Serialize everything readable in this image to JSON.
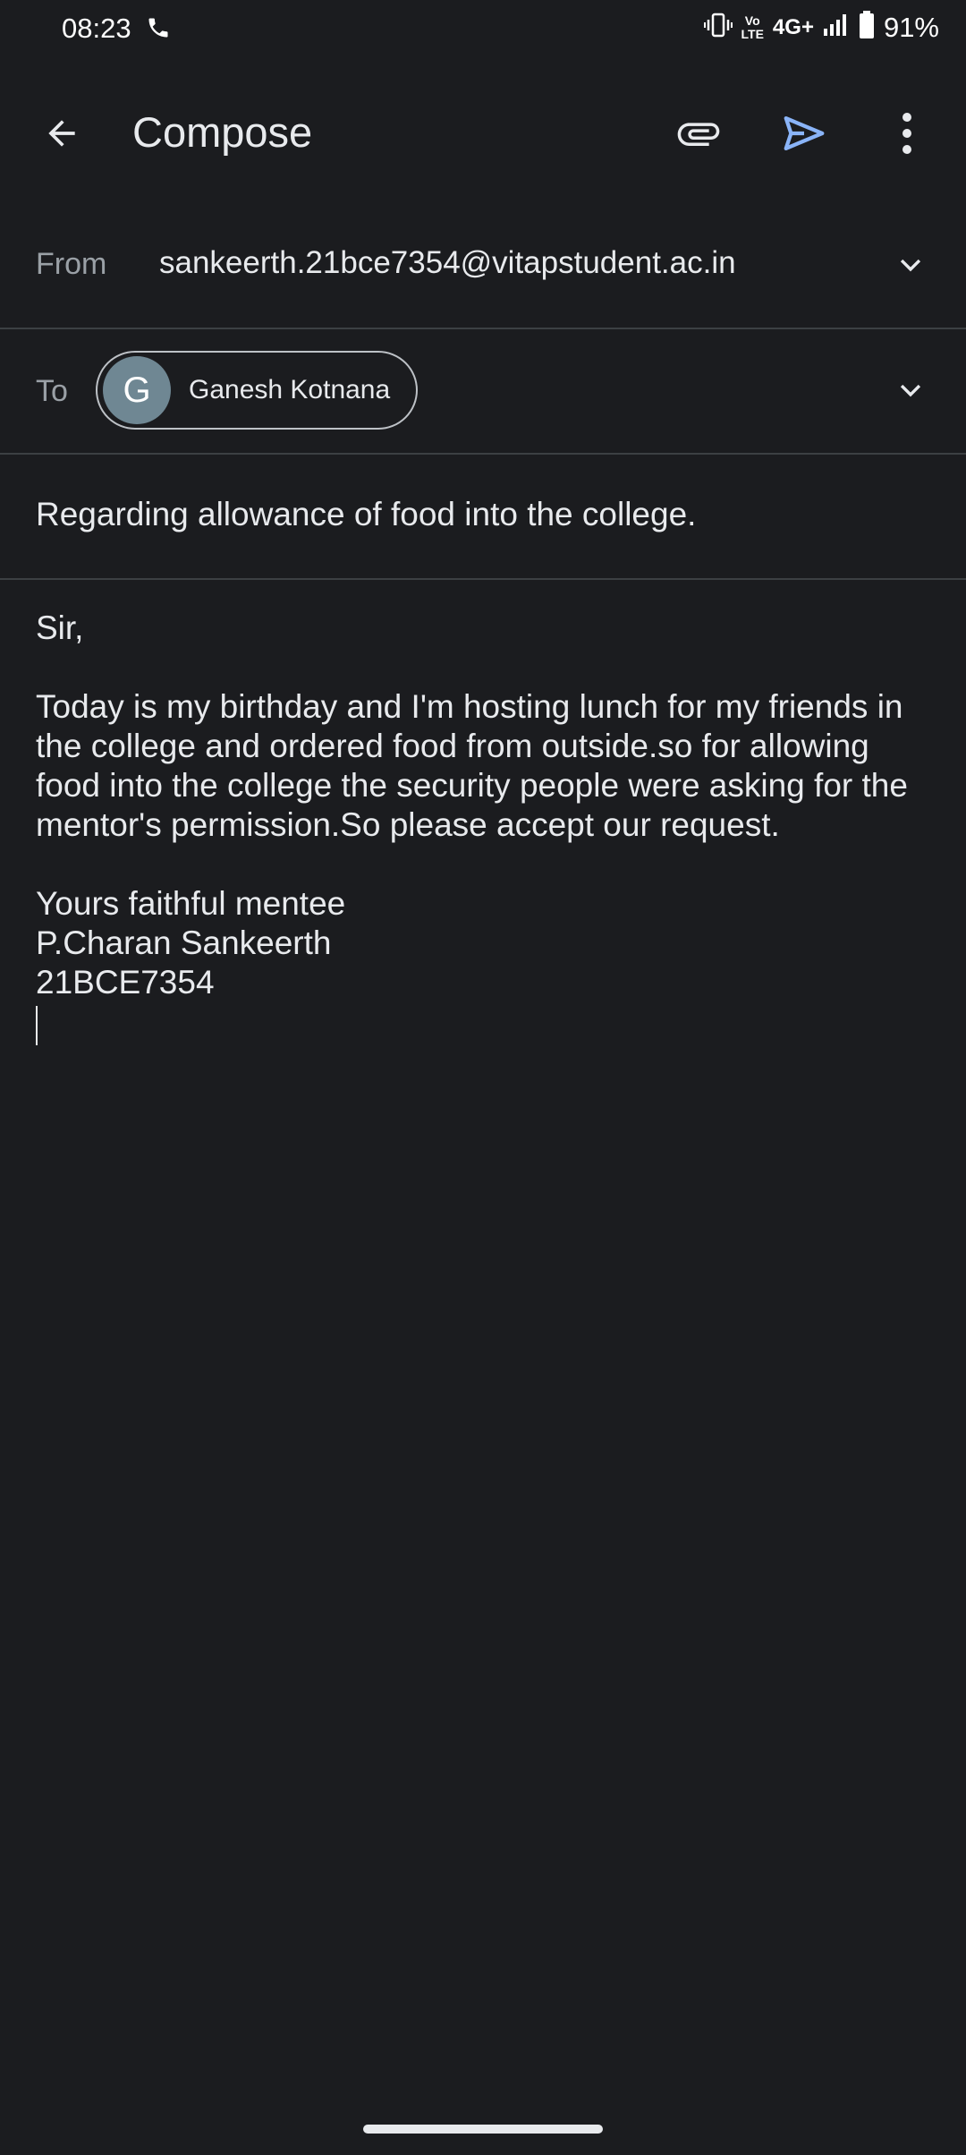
{
  "status_bar": {
    "time": "08:23",
    "network_label": "4G+",
    "volte_label_top": "Vo",
    "volte_label_bottom": "LTE",
    "battery_percent": "91%",
    "icons": [
      "phone-call-icon",
      "vibrate-icon",
      "volte-icon",
      "signal-icon",
      "battery-icon"
    ]
  },
  "app_bar": {
    "title": "Compose",
    "icons": [
      "back-arrow-icon",
      "attach-icon",
      "send-icon",
      "more-vert-icon"
    ],
    "send_color": "#8ab4f8"
  },
  "from": {
    "label": "From",
    "value": "sankeerth.21bce7354@vitapstudent.ac.in"
  },
  "to": {
    "label": "To",
    "recipient": {
      "initial": "G",
      "name": "Ganesh Kotnana",
      "avatar_color": "#6f8793"
    }
  },
  "subject": {
    "value": "Regarding allowance of food into the college."
  },
  "body": {
    "greeting": "Sir,",
    "paragraph_lines": [
      "Today is my birthday and I'm hosting lunch for my friends in",
      "the college and ordered food from outside.so for allowing",
      "food into the college the security people were asking for the",
      "mentor's permission.So please accept our request."
    ],
    "signature_lines": [
      "Yours faithful mentee",
      "P.Charan Sankeerth",
      "21BCE7354"
    ]
  },
  "theme": {
    "background": "#1b1c1f",
    "divider": "#3c4043",
    "text": "#e8eaed",
    "muted_text": "#9aa0a6"
  }
}
